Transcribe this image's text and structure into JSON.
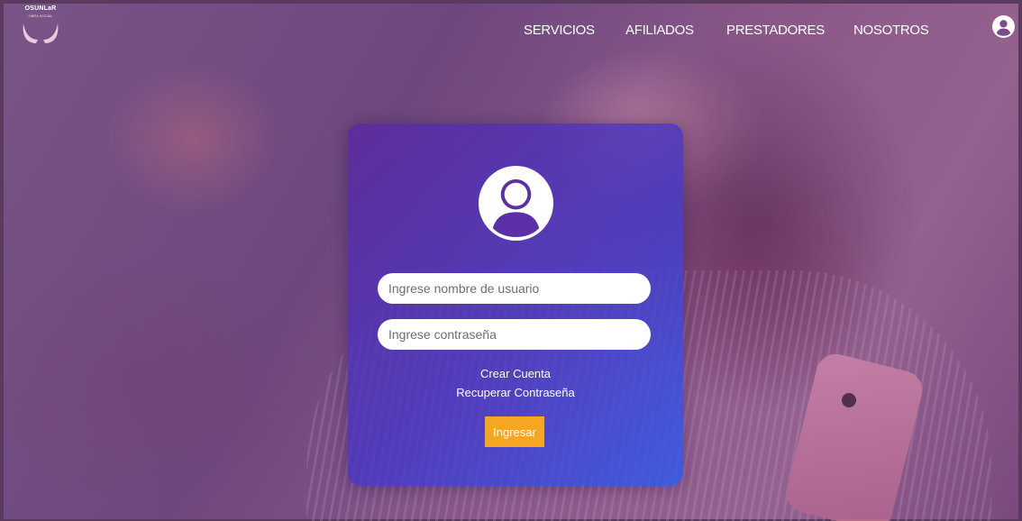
{
  "brand": {
    "name": "OSUNLaR",
    "tagline": "OBRA SOCIAL"
  },
  "nav": {
    "items": [
      "SERVICIOS",
      "AFILIADOS",
      "PRESTADORES",
      "NOSOTROS"
    ]
  },
  "login": {
    "username_placeholder": "Ingrese nombre de usuario",
    "password_placeholder": "Ingrese contraseña",
    "create_account": "Crear Cuenta",
    "recover_password": "Recuperar Contraseña",
    "submit": "Ingresar"
  },
  "colors": {
    "accent": "#f5a623",
    "card_start": "#5a28a0",
    "card_end": "#325aeb"
  },
  "icons": {
    "top_right": "user-circle-icon",
    "card": "user-avatar-icon",
    "logo": "hands-logo-icon"
  }
}
